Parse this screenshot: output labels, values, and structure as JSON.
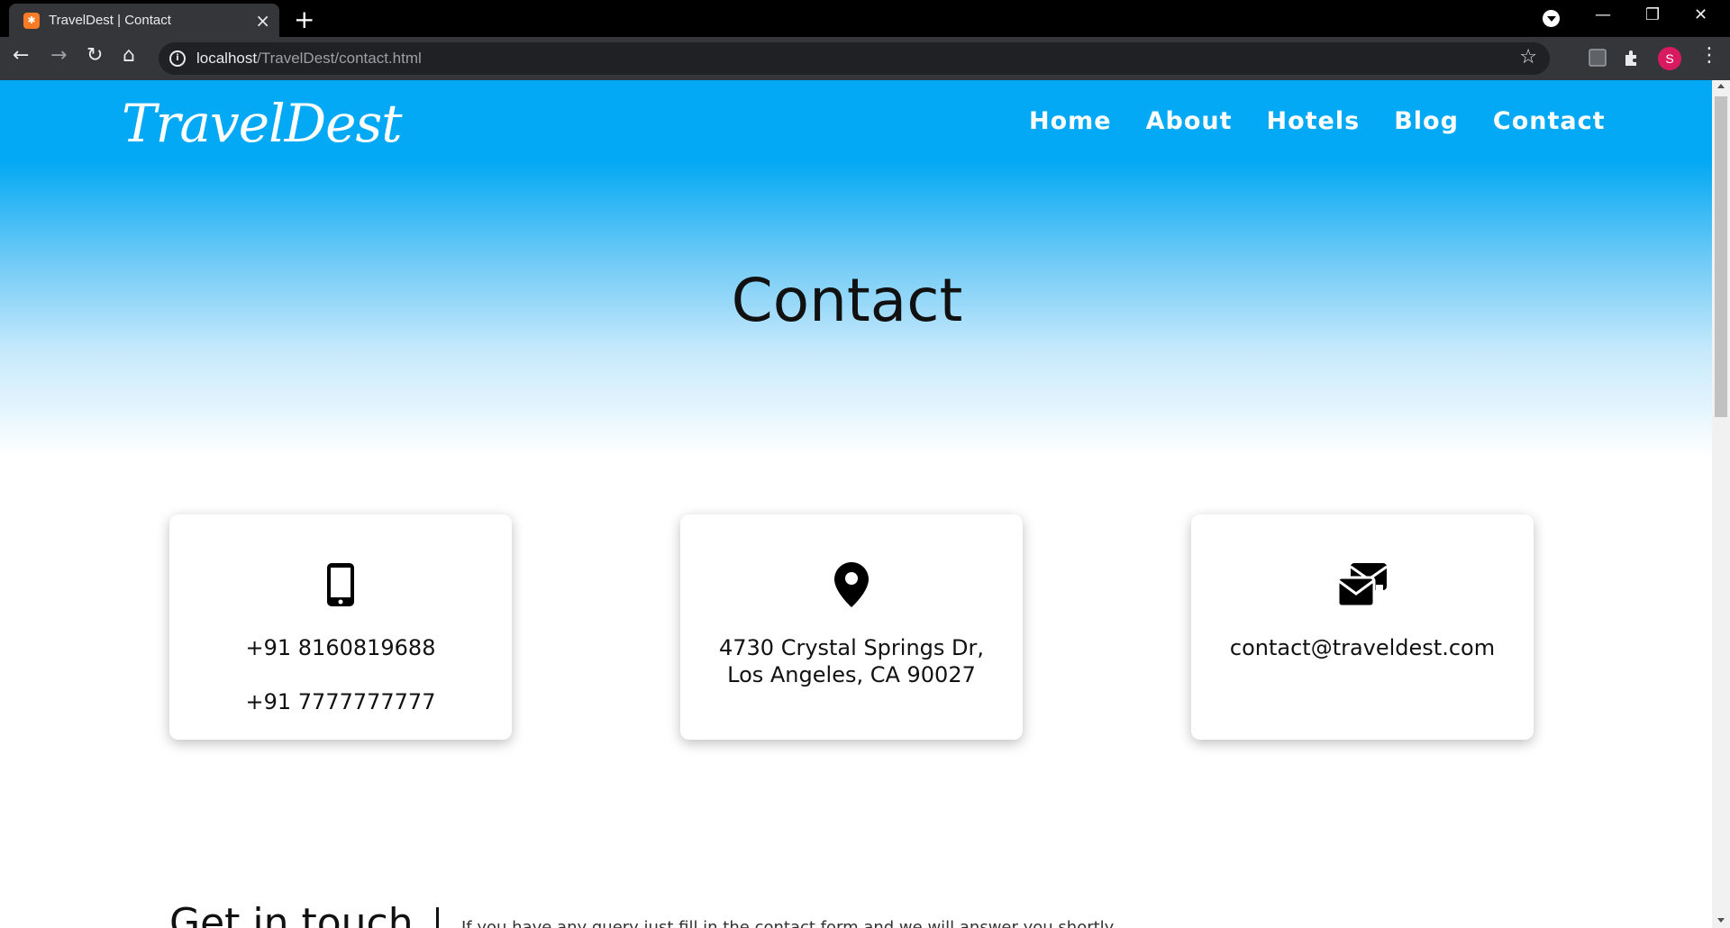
{
  "browser": {
    "tab_title": "TravelDest | Contact",
    "url_host": "localhost",
    "url_path": "/TravelDest/contact.html",
    "avatar_letter": "S"
  },
  "site": {
    "logo": "TravelDest",
    "nav": [
      "Home",
      "About",
      "Hotels",
      "Blog",
      "Contact"
    ],
    "hero_title": "Contact"
  },
  "cards": {
    "phone": {
      "icon": "mobile-phone-icon",
      "line1": "+91 8160819688",
      "line2": "+91 7777777777"
    },
    "address": {
      "icon": "map-marker-icon",
      "line1": "4730 Crystal Springs Dr,",
      "line2": "Los Angeles, CA 90027"
    },
    "email": {
      "icon": "envelopes-icon",
      "line1": "contact@traveldest.com"
    }
  },
  "touch": {
    "heading": "Get in touch",
    "text": "If you have any query just fill in the contact form and we will answer you shortly."
  },
  "colors": {
    "hero_blue": "#03a9f4",
    "text": "#111111",
    "avatar": "#d81b60"
  }
}
